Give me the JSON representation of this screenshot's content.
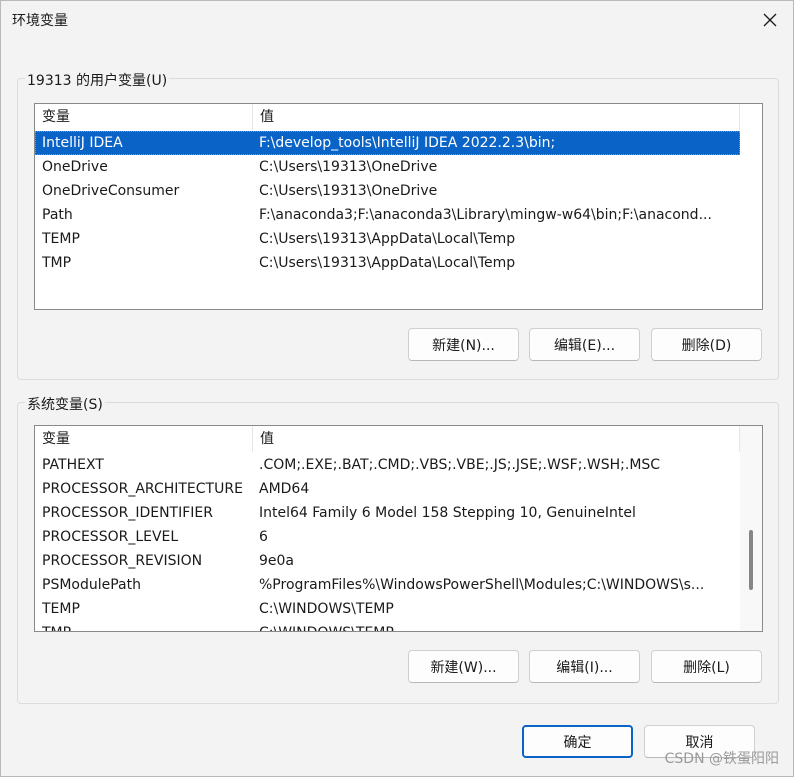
{
  "window": {
    "title": "环境变量",
    "close_label": "×"
  },
  "user_vars": {
    "group_label": "19313 的用户变量(U)",
    "columns": [
      "变量",
      "值"
    ],
    "rows": [
      {
        "name": "IntelliJ IDEA",
        "value": "F:\\develop_tools\\IntelliJ IDEA 2022.2.3\\bin;",
        "selected": true
      },
      {
        "name": "OneDrive",
        "value": "C:\\Users\\19313\\OneDrive"
      },
      {
        "name": "OneDriveConsumer",
        "value": "C:\\Users\\19313\\OneDrive"
      },
      {
        "name": "Path",
        "value": "F:\\anaconda3;F:\\anaconda3\\Library\\mingw-w64\\bin;F:\\anacond..."
      },
      {
        "name": "TEMP",
        "value": "C:\\Users\\19313\\AppData\\Local\\Temp"
      },
      {
        "name": "TMP",
        "value": "C:\\Users\\19313\\AppData\\Local\\Temp"
      }
    ],
    "buttons": {
      "new": "新建(N)...",
      "edit": "编辑(E)...",
      "delete": "删除(D)"
    }
  },
  "system_vars": {
    "group_label": "系统变量(S)",
    "columns": [
      "变量",
      "值"
    ],
    "rows": [
      {
        "name": "PATHEXT",
        "value": ".COM;.EXE;.BAT;.CMD;.VBS;.VBE;.JS;.JSE;.WSF;.WSH;.MSC"
      },
      {
        "name": "PROCESSOR_ARCHITECTURE",
        "value": "AMD64"
      },
      {
        "name": "PROCESSOR_IDENTIFIER",
        "value": "Intel64 Family 6 Model 158 Stepping 10, GenuineIntel"
      },
      {
        "name": "PROCESSOR_LEVEL",
        "value": "6"
      },
      {
        "name": "PROCESSOR_REVISION",
        "value": "9e0a"
      },
      {
        "name": "PSModulePath",
        "value": "%ProgramFiles%\\WindowsPowerShell\\Modules;C:\\WINDOWS\\s..."
      },
      {
        "name": "TEMP",
        "value": "C:\\WINDOWS\\TEMP"
      },
      {
        "name": "TMP",
        "value": "C:\\WINDOWS\\TEMP"
      }
    ],
    "scroll_position": 0.72,
    "buttons": {
      "new": "新建(W)...",
      "edit": "编辑(I)...",
      "delete": "删除(L)"
    }
  },
  "dialog_buttons": {
    "ok": "确定",
    "cancel": "取消"
  },
  "watermark": "CSDN @铁蛋阳阳",
  "colors": {
    "selection": "#0a64c8",
    "dialog_bg": "#f3f3f3",
    "primary_border": "#0a64c8"
  }
}
